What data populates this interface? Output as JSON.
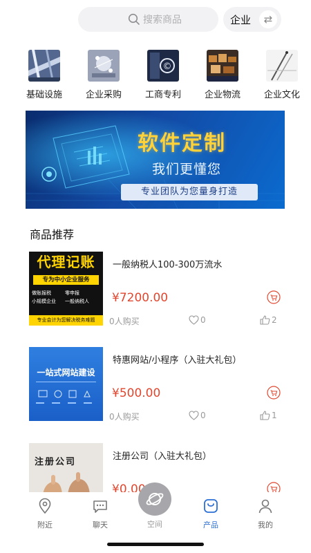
{
  "search": {
    "placeholder": "搜索商品"
  },
  "switcher": {
    "label": "企业",
    "icon": "swap-icon"
  },
  "categories": [
    {
      "label": "基础设施",
      "color": "#6b7fa8"
    },
    {
      "label": "企业采购",
      "color": "#8a97b8"
    },
    {
      "label": "工商专利",
      "color": "#2a3a5e"
    },
    {
      "label": "企业物流",
      "color": "#7b5a3a"
    },
    {
      "label": "企业文化",
      "color": "#c8c8c8"
    }
  ],
  "banner": {
    "title": "软件定制",
    "subtitle": "我们更懂您",
    "tagline": "专业团队为您量身打造"
  },
  "section": {
    "title": "商品推荐"
  },
  "products": [
    {
      "title": "一般纳税人100-300万流水",
      "price": "¥7200.00",
      "buyers": "0人购买",
      "favorites": "0",
      "likes": "2",
      "thumb": {
        "headline": "代理记账",
        "sub": "专为中小企业服务",
        "items": [
          "做账报税",
          "零申报",
          "小规模企业",
          "一般纳税人"
        ],
        "footer": "专业会计为您解决税务难题"
      }
    },
    {
      "title": "特惠网站/小程序（入驻大礼包）",
      "price": "¥500.00",
      "buyers": "0人购买",
      "favorites": "0",
      "likes": "1",
      "thumb": {
        "headline": "一站式网站建设"
      }
    },
    {
      "title": "注册公司（入驻大礼包）",
      "price": "¥0.00",
      "buyers": "",
      "favorites": "",
      "likes": "",
      "thumb": {
        "headline": "注册公司"
      }
    }
  ],
  "tabbar": {
    "nearby": "附近",
    "chat": "聊天",
    "space": "空间",
    "products": "产品",
    "mine": "我的"
  },
  "colors": {
    "accent": "#2b6fd6",
    "price": "#e0472f"
  }
}
